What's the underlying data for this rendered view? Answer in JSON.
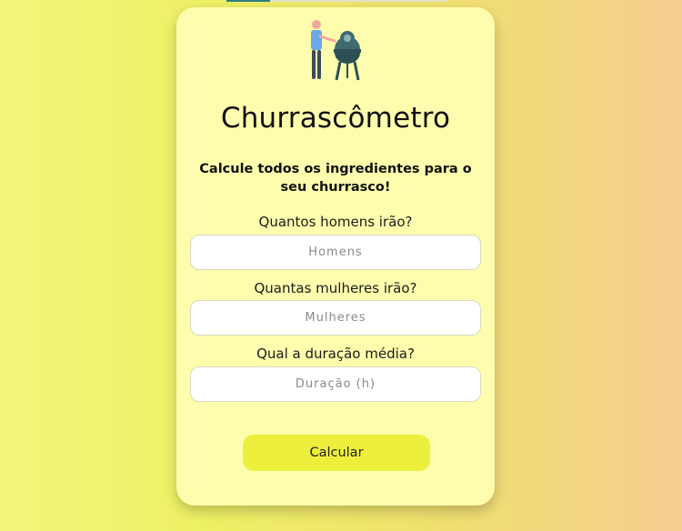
{
  "app": {
    "title": "Churrascômetro",
    "subtitle": "Calcule todos os ingredientes para o seu churrasco!"
  },
  "illustration": {
    "icon": "person-grilling-icon",
    "colors": {
      "shirt": "#6aa8e8",
      "skin": "#f4a7a0",
      "pants": "#3c4a5c",
      "grill": "#3f6a70"
    }
  },
  "form": {
    "fields": [
      {
        "label": "Quantos homens irão?",
        "placeholder": "Homens"
      },
      {
        "label": "Quantas mulheres irão?",
        "placeholder": "Mulheres"
      },
      {
        "label": "Qual a duração média?",
        "placeholder": "Duração (h)"
      }
    ],
    "submit_label": "Calcular"
  },
  "colors": {
    "card_background": "#fdfdad",
    "button_background": "#ecf03c"
  }
}
